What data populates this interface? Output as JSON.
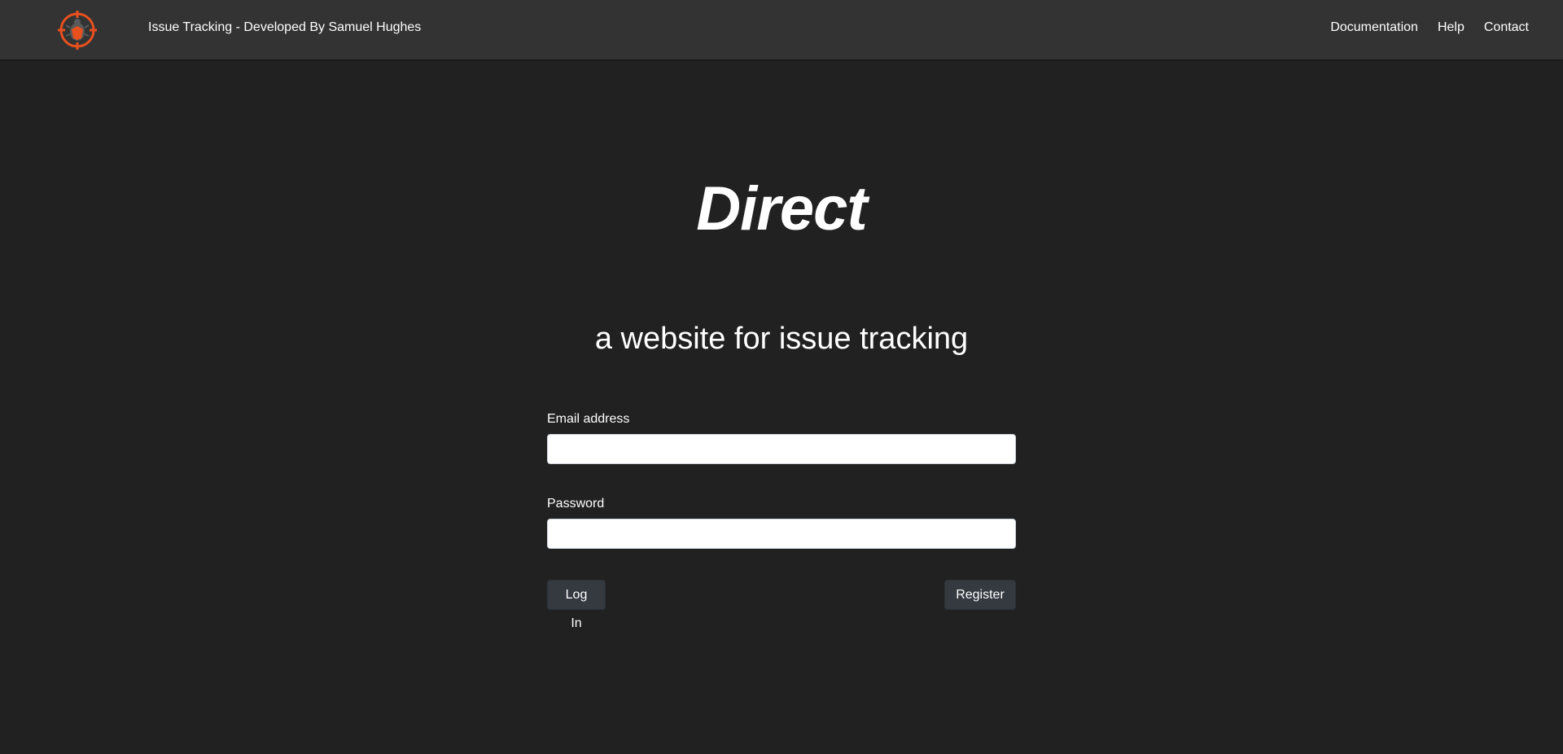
{
  "header": {
    "logo_icon": "bug-target-icon",
    "brand": "Issue Tracking - Developed By Samuel Hughes",
    "nav": [
      {
        "label": "Documentation"
      },
      {
        "label": "Help"
      },
      {
        "label": "Contact"
      }
    ]
  },
  "hero": {
    "title": "Direct",
    "subtitle": "a website for issue tracking"
  },
  "login_form": {
    "email_label": "Email address",
    "email_value": "",
    "password_label": "Password",
    "password_value": "",
    "login_button": "Log In",
    "register_button": "Register"
  },
  "colors": {
    "page_background": "#212121",
    "navbar_background": "#333333",
    "button_background": "#343a40",
    "logo_accent": "#e8501e"
  }
}
